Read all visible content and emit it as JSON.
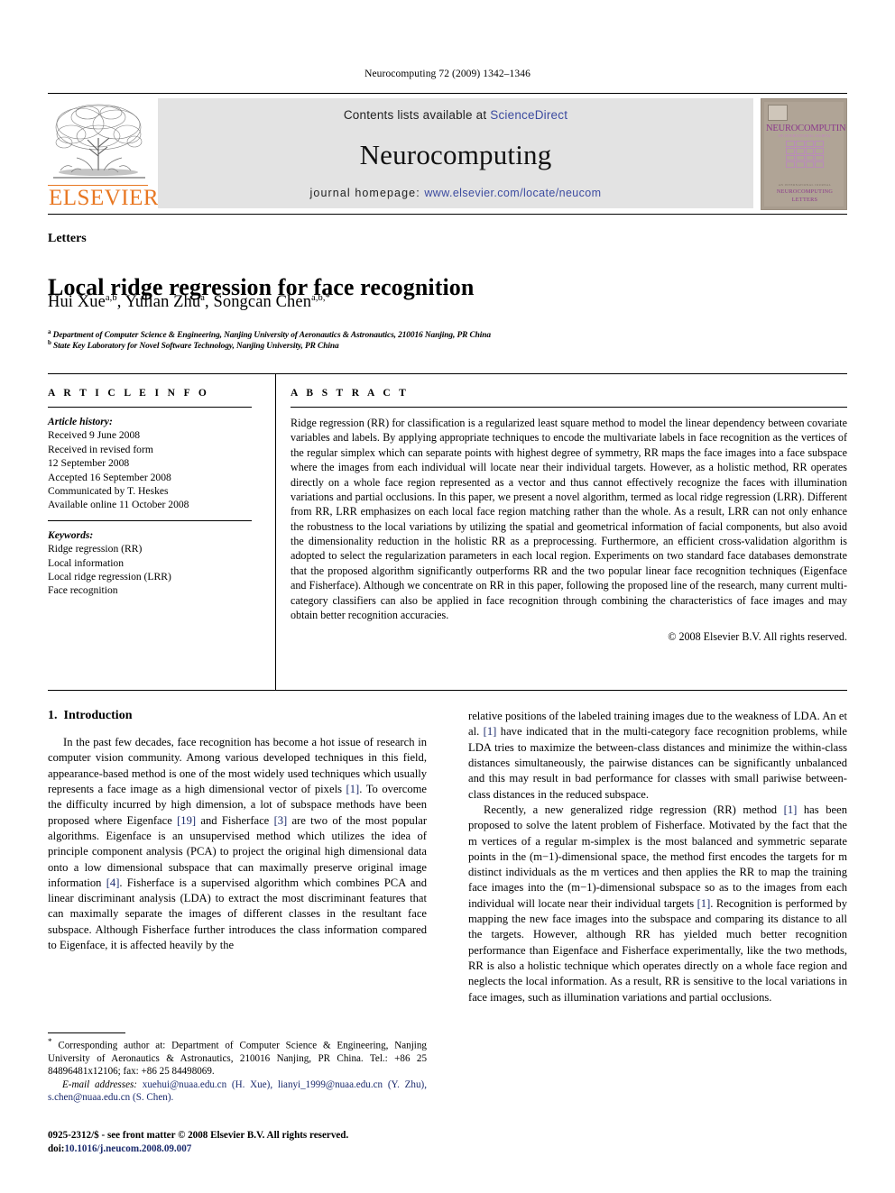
{
  "running_head": "Neurocomputing 72 (2009) 1342–1346",
  "masthead": {
    "publisher_logo_text": "ELSEVIER",
    "contents_prefix": "Contents lists available at",
    "sciencedirect": "ScienceDirect",
    "journal_name": "Neurocomputing",
    "homepage_prefix": "journal homepage:",
    "homepage_url": "www.elsevier.com/locate/neucom",
    "link_color": "#3C4BA0",
    "banner_bg": "#e3e3e3",
    "cover": {
      "title": "NEUROCOMPUTING",
      "subtitle": "AN INTERNATIONAL JOURNAL",
      "foot_small": "AN INTERNATIONAL JOURNAL",
      "foot_line1": "NEUROCOMPUTING",
      "foot_line2": "LETTERS",
      "bg_color": "#a89c8e",
      "accent_color": "#8B3A8B"
    }
  },
  "section_label": "Letters",
  "title": "Local ridge regression for face recognition",
  "authors": [
    {
      "name": "Hui Xue",
      "sup": "a,b"
    },
    {
      "name": "Yulian Zhu",
      "sup": "a"
    },
    {
      "name": "Songcan Chen",
      "sup": "a,b,*"
    }
  ],
  "affiliations": [
    {
      "marker": "a",
      "text": "Department of Computer Science & Engineering, Nanjing University of Aeronautics & Astronautics, 210016 Nanjing, PR China"
    },
    {
      "marker": "b",
      "text": "State Key Laboratory for Novel Software Technology, Nanjing University, PR China"
    }
  ],
  "article_info": {
    "heading": "A R T I C L E   I N F O",
    "history_label": "Article history:",
    "history": [
      "Received 9 June 2008",
      "Received in revised form",
      "12 September 2008",
      "Accepted 16 September 2008",
      "Communicated by T. Heskes",
      "Available online 11 October 2008"
    ],
    "keywords_label": "Keywords:",
    "keywords": [
      "Ridge regression (RR)",
      "Local information",
      "Local ridge regression (LRR)",
      "Face recognition"
    ]
  },
  "abstract": {
    "heading": "A B S T R A C T",
    "text": "Ridge regression (RR) for classification is a regularized least square method to model the linear dependency between covariate variables and labels. By applying appropriate techniques to encode the multivariate labels in face recognition as the vertices of the regular simplex which can separate points with highest degree of symmetry, RR maps the face images into a face subspace where the images from each individual will locate near their individual targets. However, as a holistic method, RR operates directly on a whole face region represented as a vector and thus cannot effectively recognize the faces with illumination variations and partial occlusions. In this paper, we present a novel algorithm, termed as local ridge regression (LRR). Different from RR, LRR emphasizes on each local face region matching rather than the whole. As a result, LRR can not only enhance the robustness to the local variations by utilizing the spatial and geometrical information of facial components, but also avoid the dimensionality reduction in the holistic RR as a preprocessing. Furthermore, an efficient cross-validation algorithm is adopted to select the regularization parameters in each local region. Experiments on two standard face databases demonstrate that the proposed algorithm significantly outperforms RR and the two popular linear face recognition techniques (Eigenface and Fisherface). Although we concentrate on RR in this paper, following the proposed line of the research, many current multi-category classifiers can also be applied in face recognition through combining the characteristics of face images and may obtain better recognition accuracies.",
    "copyright": "© 2008 Elsevier B.V. All rights reserved."
  },
  "introduction": {
    "number": "1.",
    "heading": "Introduction",
    "left_paragraphs": [
      "In the past few decades, face recognition has become a hot issue of research in computer vision community. Among various developed techniques in this field, appearance-based method is one of the most widely used techniques which usually represents a face image as a high dimensional vector of pixels [1]. To overcome the difficulty incurred by high dimension, a lot of subspace methods have been proposed where Eigenface [19] and Fisherface [3] are two of the most popular algorithms. Eigenface is an unsupervised method which utilizes the idea of principle component analysis (PCA) to project the original high dimensional data onto a low dimensional subspace that can maximally preserve original image information [4]. Fisherface is a supervised algorithm which combines PCA and linear discriminant analysis (LDA) to extract the most discriminant features that can maximally separate the images of different classes in the resultant face subspace. Although Fisherface further introduces the class information compared to Eigenface, it is affected heavily by the"
    ],
    "right_paragraphs": [
      "relative positions of the labeled training images due to the weakness of LDA. An et al. [1] have indicated that in the multi-category face recognition problems, while LDA tries to maximize the between-class distances and minimize the within-class distances simultaneously, the pairwise distances can be significantly unbalanced and this may result in bad performance for classes with small pariwise between-class distances in the reduced subspace.",
      "Recently, a new generalized ridge regression (RR) method [1] has been proposed to solve the latent problem of Fisherface. Motivated by the fact that the m vertices of a regular m-simplex is the most balanced and symmetric separate points in the (m−1)-dimensional space, the method first encodes the targets for m distinct individuals as the m vertices and then applies the RR to map the training face images into the (m−1)-dimensional subspace so as to the images from each individual will locate near their individual targets [1]. Recognition is performed by mapping the new face images into the subspace and comparing its distance to all the targets. However, although RR has yielded much better recognition performance than Eigenface and Fisherface experimentally, like the two methods, RR is also a holistic technique which operates directly on a whole face region and neglects the local information. As a result, RR is sensitive to the local variations in face images, such as illumination variations and partial occlusions."
    ]
  },
  "footnote": {
    "corresponding": "Corresponding author at: Department of Computer Science & Engineering, Nanjing University of Aeronautics & Astronautics, 210016 Nanjing, PR China. Tel.: +86 25 84896481x12106; fax: +86 25 84498069.",
    "email_label": "E-mail addresses:",
    "emails": "xuehui@nuaa.edu.cn (H. Xue), lianyi_1999@nuaa.edu.cn (Y. Zhu), s.chen@nuaa.edu.cn (S. Chen).",
    "link_color": "#1a2a6c"
  },
  "imprint": {
    "issn_line": "0925-2312/$ - see front matter © 2008 Elsevier B.V. All rights reserved.",
    "doi_prefix": "doi:",
    "doi": "10.1016/j.neucom.2008.09.007"
  }
}
